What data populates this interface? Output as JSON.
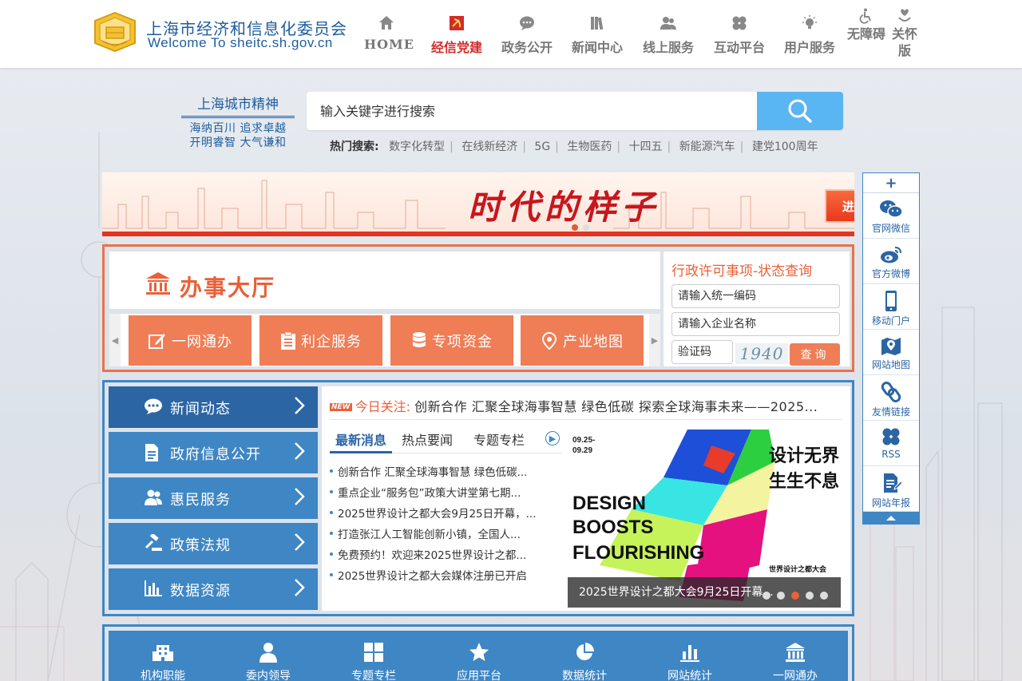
{
  "header": {
    "logo_cn": "上海市经济和信息化委员会",
    "logo_en": "Welcome To sheitc.sh.gov.cn",
    "nav": [
      {
        "label": "HOME",
        "icon": "home-icon"
      },
      {
        "label": "经信党建",
        "icon": "party-emblem-icon",
        "active": true
      },
      {
        "label": "政务公开",
        "icon": "chat-icon"
      },
      {
        "label": "新闻中心",
        "icon": "books-icon"
      },
      {
        "label": "线上服务",
        "icon": "users-icon"
      },
      {
        "label": "互动平台",
        "icon": "clover-icon"
      },
      {
        "label": "用户服务",
        "icon": "lightbulb-icon"
      }
    ],
    "accessibility": {
      "line1": "无障碍",
      "icon": "wheelchair-icon"
    },
    "elderly": {
      "line1": "关怀",
      "line2": "版",
      "icon": "care-icon"
    }
  },
  "spirit": {
    "title": "上海城市精神",
    "line1": "海纳百川 追求卓越",
    "line2": "开明睿智 大气谦和"
  },
  "search": {
    "placeholder": "输入关键字进行搜索",
    "hot_label": "热门搜索:",
    "hot_items": [
      "数字化转型",
      "在线新经济",
      "5G",
      "生物医药",
      "十四五",
      "新能源汽车",
      "建党100周年"
    ]
  },
  "banner": {
    "title": "时代的样子",
    "button": "进入专栏 》"
  },
  "hall": {
    "title": "办事大厅",
    "tiles": [
      {
        "label": "一网通办",
        "icon": "edit-icon"
      },
      {
        "label": "利企服务",
        "icon": "clipboard-icon"
      },
      {
        "label": "专项资金",
        "icon": "database-icon"
      },
      {
        "label": "产业地图",
        "icon": "map-pin-icon"
      }
    ],
    "permit": {
      "title": "行政许可事项-状态查询",
      "code_placeholder": "请输入统一编码",
      "name_placeholder": "请输入企业名称",
      "captcha_placeholder": "验证码",
      "captcha_text": "1940",
      "query_label": "查询"
    }
  },
  "news": {
    "menu": [
      {
        "label": "新闻动态",
        "icon": "chat-bubble-icon"
      },
      {
        "label": "政府信息公开",
        "icon": "document-icon"
      },
      {
        "label": "惠民服务",
        "icon": "people-icon"
      },
      {
        "label": "政策法规",
        "icon": "gavel-icon"
      },
      {
        "label": "数据资源",
        "icon": "bar-chart-icon"
      }
    ],
    "today_badge": "NEW",
    "today_label": "今日关注:",
    "today_text": "创新合作 汇聚全球海事智慧 绿色低碳 探索全球海事未来——2025...",
    "tabs": [
      "最新消息",
      "热点要闻",
      "专题专栏"
    ],
    "items": [
      "创新合作 汇聚全球海事智慧 绿色低碳...",
      "重点企业“服务包”政策大讲堂第七期...",
      "2025世界设计之都大会9月25日开幕，...",
      "打造张江人工智能创新小镇，全国人...",
      "免费预约！欢迎来2025世界设计之都...",
      "2025世界设计之都大会媒体注册已开启"
    ],
    "feature": {
      "caption": "2025世界设计之都大会9月25日开幕...",
      "dates": "09.25-\n09.29",
      "poster_en1": "DESIGN",
      "poster_en2": "BOOSTS",
      "poster_en3": "FLOURISHING",
      "poster_cn1": "设计无界",
      "poster_cn2": "生生不息",
      "poster_org": "世界设计之都大会"
    }
  },
  "bottom": [
    {
      "label": "机构职能",
      "icon": "building-icon"
    },
    {
      "label": "委内领导",
      "icon": "person-icon"
    },
    {
      "label": "专题专栏",
      "icon": "grid-icon"
    },
    {
      "label": "应用平台",
      "icon": "star-icon"
    },
    {
      "label": "数据统计",
      "icon": "pie-chart-icon"
    },
    {
      "label": "网站统计",
      "icon": "bar-chart-icon"
    },
    {
      "label": "一网通办",
      "icon": "bank-icon"
    }
  ],
  "rbar": {
    "top": "+",
    "items": [
      {
        "label": "官网微信",
        "icon": "wechat-icon"
      },
      {
        "label": "官方微博",
        "icon": "weibo-icon"
      },
      {
        "label": "移动门户",
        "icon": "mobile-icon"
      },
      {
        "label": "网站地图",
        "icon": "map-icon"
      },
      {
        "label": "友情链接",
        "icon": "link-icon"
      },
      {
        "label": "RSS",
        "icon": "rss-icon"
      },
      {
        "label": "网站年报",
        "icon": "report-icon"
      }
    ]
  },
  "colors": {
    "primary_blue": "#3f86c4",
    "dark_blue": "#2b65a3",
    "orange": "#ef7d55",
    "red_active": "#d22b2b"
  }
}
